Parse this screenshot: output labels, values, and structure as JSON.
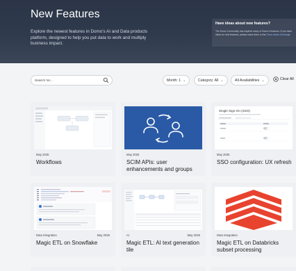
{
  "hero": {
    "title": "New Features",
    "description": "Explore the newest features in Domo's AI and Data products platform, designed to help you put data to work and multiply business impact.",
    "idea_title": "Have ideas about new features?",
    "idea_text": "The Domo Community has inspired many of Domo's features. If you have ideas for new features, please share them in the",
    "idea_link": "Domo Ideas Exchange"
  },
  "filters": {
    "search_placeholder": "Search for...",
    "month": "Month: 1",
    "category": "Category: All",
    "availability": "All Availabilities",
    "clear": "Clear All"
  },
  "cards": [
    {
      "date": "May 2025",
      "category": "",
      "title": "Workflows"
    },
    {
      "date": "May 2025",
      "category": "",
      "title": "SCIM APIs: user enhancements and groups"
    },
    {
      "date": "May 2025",
      "category": "",
      "title": "SSO configuration: UX refresh",
      "thumb_heading": "Single Sign-On (SSO)"
    },
    {
      "date": "May 2025",
      "category": "Data Integration",
      "title": "Magic ETL on Snowflake"
    },
    {
      "date": "May 2025",
      "category": "AI",
      "title": "Magic ETL: AI text generation tile"
    },
    {
      "date": "",
      "category": "Data Integration",
      "title": "Magic ETL on Databricks subset processing"
    }
  ],
  "colors": {
    "hero_bg": "#2f3a4d",
    "scim_blue": "#2a5aa6",
    "databricks_red": "#e8432f"
  }
}
